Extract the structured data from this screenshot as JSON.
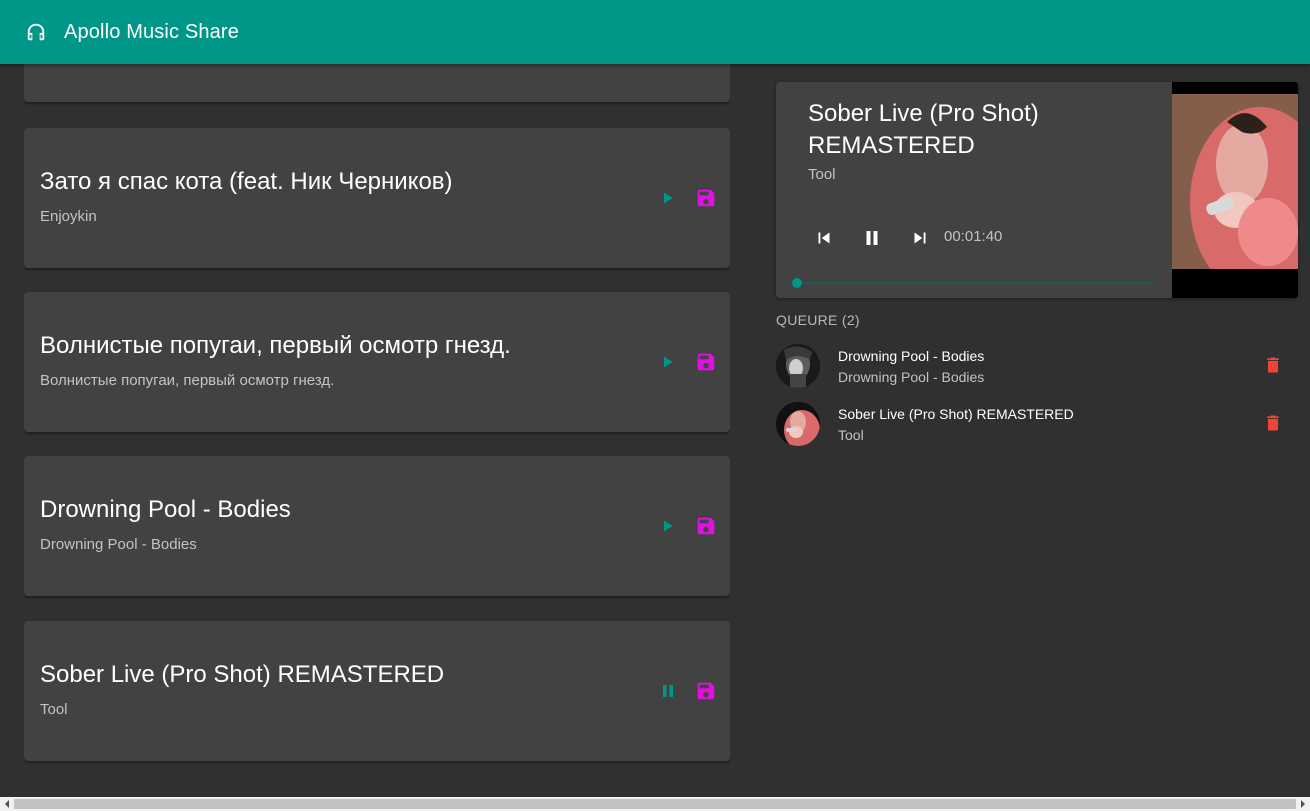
{
  "app": {
    "title": "Apollo Music Share",
    "logo_icon": "headphones-icon"
  },
  "colors": {
    "primary": "#009688",
    "save_accent": "#e010e0",
    "delete": "#f44336",
    "card": "#424242",
    "background": "#303030"
  },
  "songs": [
    {
      "title": "",
      "artist": "",
      "state": "idle"
    },
    {
      "title": "Зато я спас кота (feat. Ник Черников)",
      "artist": "Enjoykin",
      "state": "idle"
    },
    {
      "title": "Волнистые попугаи, первый осмотр гнезд.",
      "artist": "Волнистые попугаи, первый осмотр гнезд.",
      "state": "idle"
    },
    {
      "title": "Drowning Pool - Bodies",
      "artist": "Drowning Pool - Bodies",
      "state": "idle"
    },
    {
      "title": "Sober Live (Pro Shot) REMASTERED",
      "artist": "Tool",
      "state": "playing"
    }
  ],
  "player": {
    "title": "Sober Live (Pro Shot) REMASTERED",
    "artist": "Tool",
    "time": "00:01:40",
    "progress": 0.0,
    "state": "playing"
  },
  "queue": {
    "header": "QUEURE (2)",
    "items": [
      {
        "title": "Drowning Pool - Bodies",
        "artist": "Drowning Pool - Bodies"
      },
      {
        "title": "Sober Live (Pro Shot) REMASTERED",
        "artist": "Tool"
      }
    ]
  }
}
